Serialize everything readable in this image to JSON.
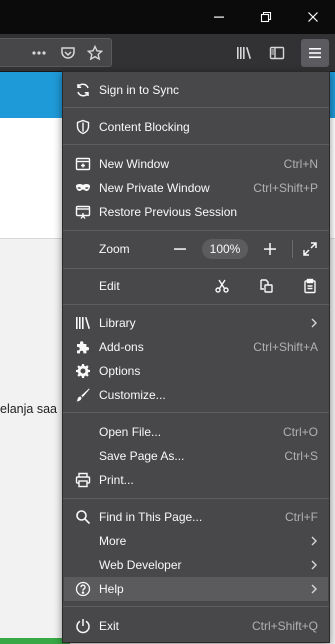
{
  "page": {
    "partial_text": "elanja saa"
  },
  "menu": {
    "sign_in": "Sign in to Sync",
    "content_blocking": "Content Blocking",
    "new_window": {
      "label": "New Window",
      "shortcut": "Ctrl+N"
    },
    "new_private_window": {
      "label": "New Private Window",
      "shortcut": "Ctrl+Shift+P"
    },
    "restore_session": "Restore Previous Session",
    "zoom": {
      "label": "Zoom",
      "value": "100%"
    },
    "edit": {
      "label": "Edit"
    },
    "library": "Library",
    "addons": {
      "label": "Add-ons",
      "shortcut": "Ctrl+Shift+A"
    },
    "options": "Options",
    "customize": "Customize...",
    "open_file": {
      "label": "Open File...",
      "shortcut": "Ctrl+O"
    },
    "save_page": {
      "label": "Save Page As...",
      "shortcut": "Ctrl+S"
    },
    "print": "Print...",
    "find": {
      "label": "Find in This Page...",
      "shortcut": "Ctrl+F"
    },
    "more": "More",
    "web_developer": "Web Developer",
    "help": "Help",
    "exit": {
      "label": "Exit",
      "shortcut": "Ctrl+Shift+Q"
    }
  },
  "colors": {
    "panel_bg": "#48484a",
    "hover_bg": "#5b5b5e",
    "toolbar_bg": "#323234",
    "page_accent": "#1f9ad8"
  },
  "icons": [
    "sync-icon",
    "shield-icon",
    "new-window-icon",
    "private-mask-icon",
    "restore-session-icon",
    "library-icon",
    "puzzle-icon",
    "gear-icon",
    "paintbrush-icon",
    "printer-icon",
    "search-icon",
    "help-icon",
    "power-icon"
  ]
}
